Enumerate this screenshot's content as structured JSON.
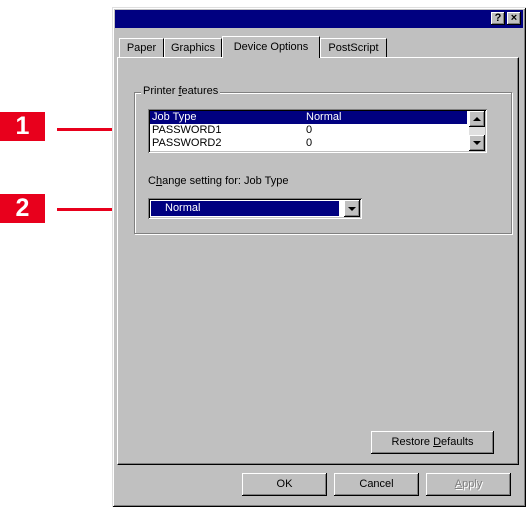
{
  "window": {
    "help_btn": "?",
    "close_btn": "×"
  },
  "tabs": [
    {
      "label": "Paper"
    },
    {
      "label": "Graphics"
    },
    {
      "label": "Device Options",
      "active": true
    },
    {
      "label": "PostScript"
    }
  ],
  "printer_features": {
    "group_label_pre": "Printer ",
    "group_label_u": "f",
    "group_label_post": "eatures",
    "items": [
      {
        "name": "Job Type",
        "value": "Normal",
        "selected": true
      },
      {
        "name": "PASSWORD1",
        "value": "0"
      },
      {
        "name": "PASSWORD2",
        "value": "0"
      }
    ]
  },
  "change_setting": {
    "label_pre": "C",
    "label_u": "h",
    "label_post": "ange setting for:  Job Type",
    "value": "Normal"
  },
  "buttons": {
    "restore_pre": "Restore ",
    "restore_u": "D",
    "restore_post": "efaults",
    "ok": "OK",
    "cancel": "Cancel",
    "apply_u": "A",
    "apply_post": "pply"
  },
  "callouts": {
    "one": "1",
    "two": "2"
  },
  "colors": {
    "callout": "#e8001c",
    "titlebar": "#000080",
    "face": "#c0c0c0"
  }
}
